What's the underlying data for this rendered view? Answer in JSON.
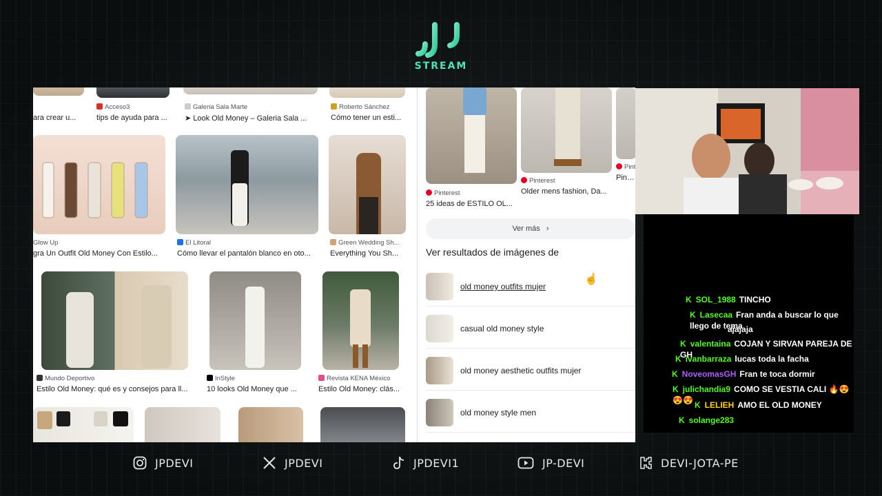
{
  "logo": {
    "text": "STREAM"
  },
  "browser": {
    "row1": [
      {
        "source": "",
        "caption": "ara crear u..."
      },
      {
        "source": "Acceso3",
        "caption": "tips de ayuda para ..."
      },
      {
        "source": "Galeria Sala Marte",
        "caption": "➤ Look Old Money – Galeria Sala ..."
      },
      {
        "source": "Roberto Sánchez",
        "caption": "Cómo tener un esti..."
      }
    ],
    "row2": [
      {
        "source": "Glow Up",
        "caption": "gra Un Outfit Old Money Con Estilo..."
      },
      {
        "source": "El Litoral",
        "caption": "Cómo llevar el pantalón blanco en oto..."
      },
      {
        "source": "Green Wedding Sh...",
        "caption": "Everything You Sh..."
      }
    ],
    "row3": [
      {
        "source": "Mundo Deportivo",
        "caption": "Estilo Old Money: qué es y consejos para ll..."
      },
      {
        "source": "InStyle",
        "caption": "10 looks Old Money que ..."
      },
      {
        "source": "Revista KENA México",
        "caption": "Estilo Old Money: clás..."
      }
    ],
    "right": {
      "top_items": [
        {
          "source": "Pinterest",
          "caption": "25 ideas de ESTILO OL..."
        },
        {
          "source": "Pinterest",
          "caption": "Older mens fashion, Da..."
        },
        {
          "source": "Pint",
          "caption": "Pin by"
        }
      ],
      "ver_mas": "Ver más",
      "section_title": "Ver resultados de imágenes de",
      "related": [
        "old money outfits mujer",
        "casual old money style",
        "old money aesthetic outfits mujer",
        "old money style men"
      ]
    }
  },
  "chat": {
    "messages": [
      {
        "user": "SOL_1988",
        "color": "#53fc18",
        "text": "TINCHO"
      },
      {
        "user": "Lasecaa",
        "color": "#53fc18",
        "text": "Fran anda a buscar lo que llego de tema"
      },
      {
        "user": "",
        "color": "#ffffff",
        "text": "ajajaja"
      },
      {
        "user": "valentaina",
        "color": "#53fc18",
        "text": "COJAN Y SIRVAN PAREJA DE GH"
      },
      {
        "user": "ivanbarraza",
        "color": "#53fc18",
        "text": "lucas toda la facha"
      },
      {
        "user": "NoveomasGH",
        "color": "#b05cff",
        "text": "Fran te toca dormir"
      },
      {
        "user": "julichandia9",
        "color": "#53fc18",
        "text": "COMO SE VESTIA CALI 🔥😍😍😍"
      },
      {
        "user": "LELIEH",
        "color": "#ffd400",
        "text": "AMO EL OLD MONEY"
      },
      {
        "user": "solange283",
        "color": "#53fc18",
        "text": ""
      }
    ],
    "badge": "K"
  },
  "footer": {
    "socials": [
      {
        "icon": "instagram-icon",
        "label": "JPDEVI"
      },
      {
        "icon": "x-icon",
        "label": "JPDEVI"
      },
      {
        "icon": "tiktok-icon",
        "label": "JPDEVI1"
      },
      {
        "icon": "youtube-icon",
        "label": "JP-DEVI"
      },
      {
        "icon": "kick-icon",
        "label": "DEVI-JOTA-PE"
      }
    ]
  },
  "colors": {
    "accent": "#4fe3b5",
    "kick_green": "#53fc18"
  }
}
